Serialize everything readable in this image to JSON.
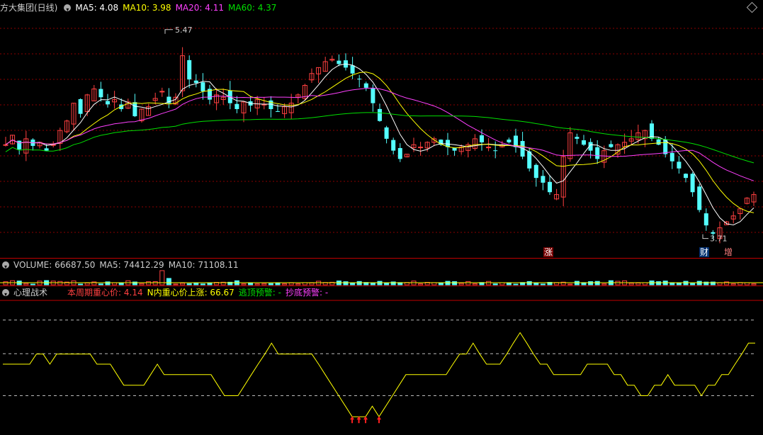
{
  "main_header": {
    "title": "方大集团(日线)",
    "ma5": "MA5: 4.08",
    "ma10": "MA10: 3.98",
    "ma20": "MA20: 4.11",
    "ma60": "MA60: 4.37",
    "icon": "chevron-down-icon",
    "right_icon": "diamond-icon"
  },
  "annotations": {
    "high": "5.47",
    "low": "3.71",
    "tag_zhang": "涨",
    "tag_cai": "财",
    "tag_zeng": "增"
  },
  "volume_header": {
    "volume": "VOLUME: 66687.50",
    "ma5": "MA5: 74412.29",
    "ma10": "MA10: 71108.11"
  },
  "indicator_header": {
    "name": "心理战术",
    "p1": "本周期重心价: 4.14",
    "p2": "N内重心价上涨: 66.67",
    "p3": "逃顶预警: -",
    "p4": "抄底预警: -"
  },
  "colors": {
    "up": "#ff4040",
    "down": "#54ffff",
    "ma5": "#ffffff",
    "ma10": "#ffff00",
    "ma20": "#ff40ff",
    "ma60": "#00e000",
    "grid": "#8b0000",
    "psy_line": "#ffff00"
  },
  "chart_data": [
    {
      "type": "candlestick",
      "title": "方大集团(日线)",
      "ylim": [
        3.6,
        5.6
      ],
      "annotations": [
        {
          "label": "5.47",
          "value": 5.47
        },
        {
          "label": "3.71",
          "value": 3.71
        }
      ],
      "series": [
        {
          "name": "MA5",
          "value": 4.08
        },
        {
          "name": "MA10",
          "value": 3.98
        },
        {
          "name": "MA20",
          "value": 4.11
        },
        {
          "name": "MA60",
          "value": 4.37
        }
      ],
      "close": [
        4.5,
        4.58,
        4.46,
        4.55,
        4.49,
        4.52,
        4.45,
        4.5,
        4.62,
        4.7,
        4.85,
        4.76,
        4.92,
        4.97,
        4.9,
        4.84,
        4.88,
        4.8,
        4.86,
        4.74,
        4.8,
        4.82,
        4.89,
        4.95,
        4.85,
        4.9,
        5.25,
        5.05,
        5.02,
        4.95,
        4.88,
        4.92,
        4.9,
        4.85,
        4.8,
        4.86,
        4.83,
        4.88,
        4.84,
        4.8,
        4.78,
        4.82,
        4.85,
        4.92,
        5.0,
        5.1,
        5.15,
        5.2,
        5.22,
        5.18,
        5.15,
        5.1,
        5.05,
        4.98,
        4.85,
        4.7,
        4.55,
        4.45,
        4.38,
        4.42,
        4.5,
        4.48,
        4.52,
        4.55,
        4.5,
        4.48,
        4.45,
        4.48,
        4.5,
        4.55,
        4.52,
        4.48,
        4.45,
        4.5,
        4.52,
        4.48,
        4.4,
        4.3,
        4.22,
        4.18,
        4.1,
        4.08,
        4.4,
        4.6,
        4.55,
        4.5,
        4.45,
        4.38,
        4.45,
        4.48,
        4.5,
        4.52,
        4.55,
        4.6,
        4.62,
        4.55,
        4.5,
        4.42,
        4.36,
        4.3,
        4.22,
        4.1,
        3.95,
        3.82,
        3.75,
        3.8,
        3.85,
        3.9,
        3.96,
        4.05,
        4.08
      ]
    },
    {
      "type": "bar",
      "title": "VOLUME",
      "series": [
        {
          "name": "VOLUME",
          "value": 66687.5
        },
        {
          "name": "MA5",
          "value": 74412.29
        },
        {
          "name": "MA10",
          "value": 71108.11
        }
      ]
    },
    {
      "type": "line",
      "title": "心理战术",
      "ylim": [
        0,
        100
      ],
      "series": [
        {
          "name": "本周期重心价",
          "value": 4.14
        },
        {
          "name": "N内重心价上涨",
          "value": 66.67
        }
      ],
      "values": [
        50,
        50,
        50,
        50,
        50,
        58,
        58,
        50,
        58,
        58,
        58,
        58,
        58,
        58,
        50,
        50,
        50,
        41.7,
        33.3,
        33.3,
        33.3,
        33.3,
        41.7,
        50,
        41.7,
        41.7,
        41.7,
        41.7,
        41.7,
        41.7,
        41.7,
        41.7,
        33.3,
        25,
        25,
        25,
        33.3,
        41.7,
        50,
        58,
        66.7,
        58,
        58,
        58,
        58,
        58,
        58,
        50,
        41.7,
        33.3,
        25,
        16.7,
        8.3,
        8.3,
        8.3,
        16.7,
        8.3,
        16.7,
        25,
        33.3,
        41.7,
        41.7,
        41.7,
        41.7,
        41.7,
        41.7,
        41.7,
        50,
        58,
        58,
        66.7,
        58,
        50,
        50,
        50,
        58,
        66.7,
        75,
        66.7,
        58,
        50,
        50,
        41.7,
        41.7,
        41.7,
        41.7,
        41.7,
        50,
        50,
        50,
        50,
        41.7,
        41.7,
        33.3,
        33.3,
        25,
        25,
        33.3,
        33.3,
        41.7,
        33.3,
        33.3,
        33.3,
        33.3,
        25,
        33.3,
        33.3,
        41.7,
        41.7,
        50,
        58,
        66.7,
        66.7
      ]
    }
  ]
}
